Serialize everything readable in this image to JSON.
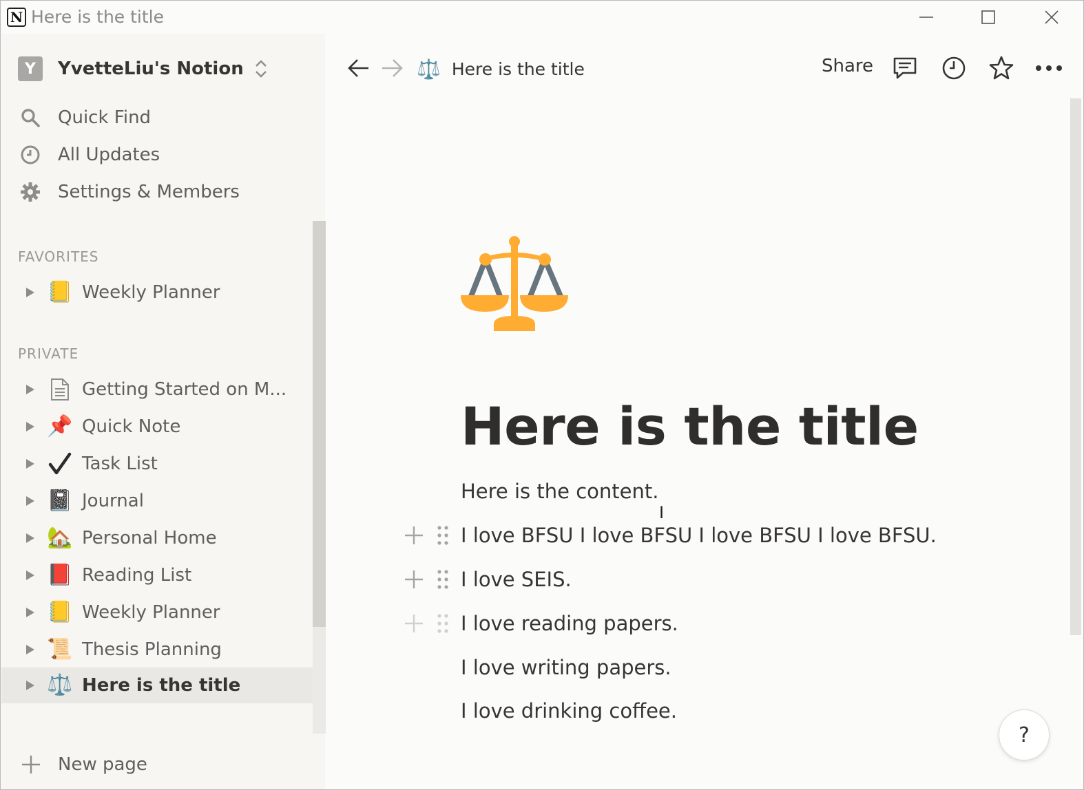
{
  "window": {
    "title": "Here is the title",
    "app_logo_letter": "N"
  },
  "sidebar": {
    "workspace": {
      "avatar_letter": "Y",
      "name": "YvetteLiu's Notion"
    },
    "menu": [
      {
        "label": "Quick Find",
        "icon": "search-icon"
      },
      {
        "label": "All Updates",
        "icon": "clock-icon"
      },
      {
        "label": "Settings & Members",
        "icon": "gear-icon"
      }
    ],
    "favorites": {
      "label": "FAVORITES",
      "items": [
        {
          "label": "Weekly Planner",
          "emoji": "📒"
        }
      ]
    },
    "private": {
      "label": "PRIVATE",
      "items": [
        {
          "label": "Getting Started on M...",
          "emoji": "📄"
        },
        {
          "label": "Quick Note",
          "emoji": "📌"
        },
        {
          "label": "Task List",
          "emoji": "✔️"
        },
        {
          "label": "Journal",
          "emoji": "📓"
        },
        {
          "label": "Personal Home",
          "emoji": "🏡"
        },
        {
          "label": "Reading List",
          "emoji": "📕"
        },
        {
          "label": "Weekly Planner",
          "emoji": "📒"
        },
        {
          "label": "Thesis Planning",
          "emoji": "📜"
        },
        {
          "label": "Here is the title",
          "emoji": "⚖️",
          "active": true
        }
      ]
    },
    "new_page_label": "New page"
  },
  "topbar": {
    "breadcrumb_title": "Here is the title",
    "breadcrumb_emoji": "⚖️",
    "share_label": "Share"
  },
  "page": {
    "title": "Here is the title",
    "icon": "balance-scale-icon",
    "blocks": [
      "Here is the content.",
      "I love BFSU I love BFSU I love BFSU I love BFSU.",
      "I love SEIS.",
      "I love reading papers.",
      "I love writing papers.",
      "I love drinking coffee."
    ]
  },
  "help_label": "?",
  "colors": {
    "sidebar_bg": "#f7f6f3",
    "main_bg": "#fbfbfa",
    "text": "#37352f",
    "accent_scale": "#ffac33"
  }
}
